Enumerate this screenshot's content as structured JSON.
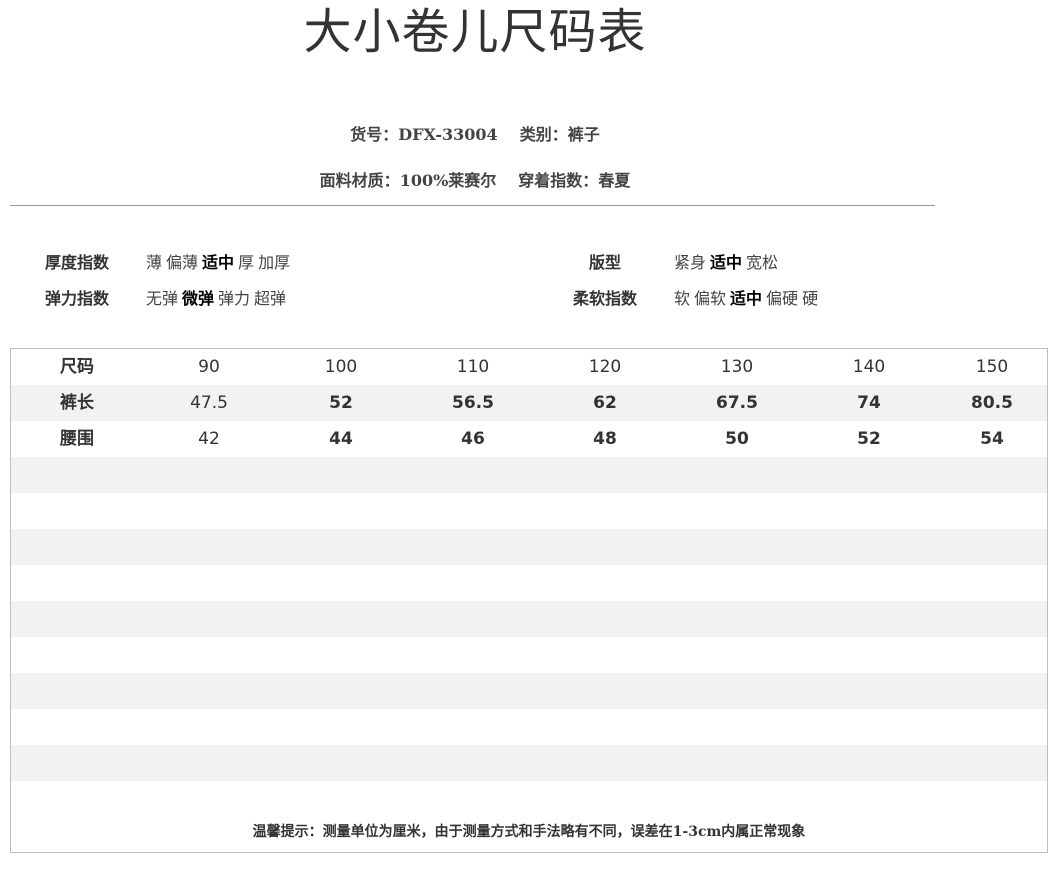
{
  "title": "大小卷儿尺码表",
  "meta": {
    "item_no_label": "货号：",
    "item_no": "DFX-33004",
    "category_label": "类别：",
    "category": "裤子",
    "fabric_label": "面料材质：",
    "fabric": "100%莱赛尔",
    "season_label": "穿着指数：",
    "season": "春夏"
  },
  "attributes": {
    "thickness": {
      "label": "厚度指数",
      "options": [
        "薄",
        "偏薄",
        "适中",
        "厚",
        "加厚"
      ],
      "selected": "适中"
    },
    "elasticity": {
      "label": "弹力指数",
      "options": [
        "无弹",
        "微弹",
        "弹力",
        "超弹"
      ],
      "selected": "微弹"
    },
    "fit": {
      "label": "版型",
      "options": [
        "紧身",
        "适中",
        "宽松"
      ],
      "selected": "适中"
    },
    "softness": {
      "label": "柔软指数",
      "options": [
        "软",
        "偏软",
        "适中",
        "偏硬",
        "硬"
      ],
      "selected": "适中"
    }
  },
  "size_table": {
    "headers": [
      "尺码",
      "90",
      "100",
      "110",
      "120",
      "130",
      "140",
      "150"
    ],
    "rows": [
      [
        "裤长",
        "47.5",
        "52",
        "56.5",
        "62",
        "67.5",
        "74",
        "80.5"
      ],
      [
        "腰围",
        "42",
        "44",
        "46",
        "48",
        "50",
        "52",
        "54"
      ]
    ]
  },
  "footer_tip": "温馨提示：测量单位为厘米，由于测量方式和手法略有不同，误差在1-3cm内属正常现象"
}
